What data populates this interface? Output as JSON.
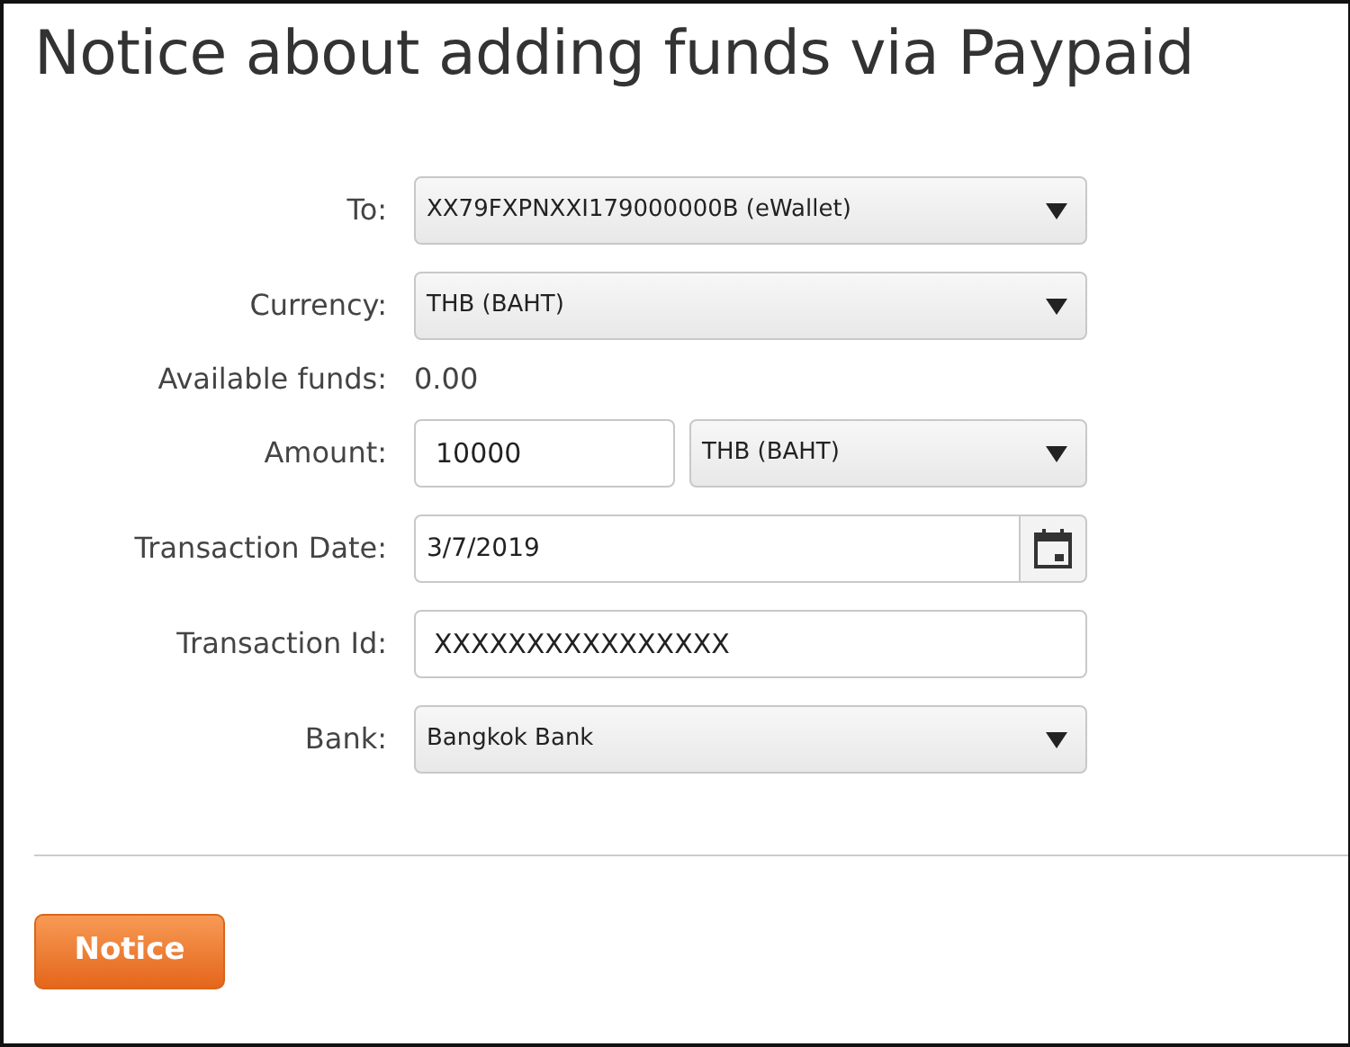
{
  "title": "Notice about adding funds via Paypaid",
  "fields": [
    {
      "kind": "select",
      "label": "To:",
      "value": "XX79FXPNXXI179000000B (eWallet)"
    },
    {
      "kind": "select",
      "label": "Currency:",
      "value": "THB (BAHT)"
    },
    {
      "kind": "static",
      "label": "Available funds:",
      "value": "0.00"
    },
    {
      "kind": "amount",
      "label": "Amount:",
      "value": "10000",
      "currency": "THB (BAHT)"
    },
    {
      "kind": "date",
      "label": "Transaction Date:",
      "value": "3/7/2019"
    },
    {
      "kind": "text",
      "label": "Transaction Id:",
      "value": "XXXXXXXXXXXXXXXX"
    },
    {
      "kind": "select",
      "label": "Bank:",
      "value": "Bangkok Bank"
    }
  ],
  "submit": "Notice"
}
